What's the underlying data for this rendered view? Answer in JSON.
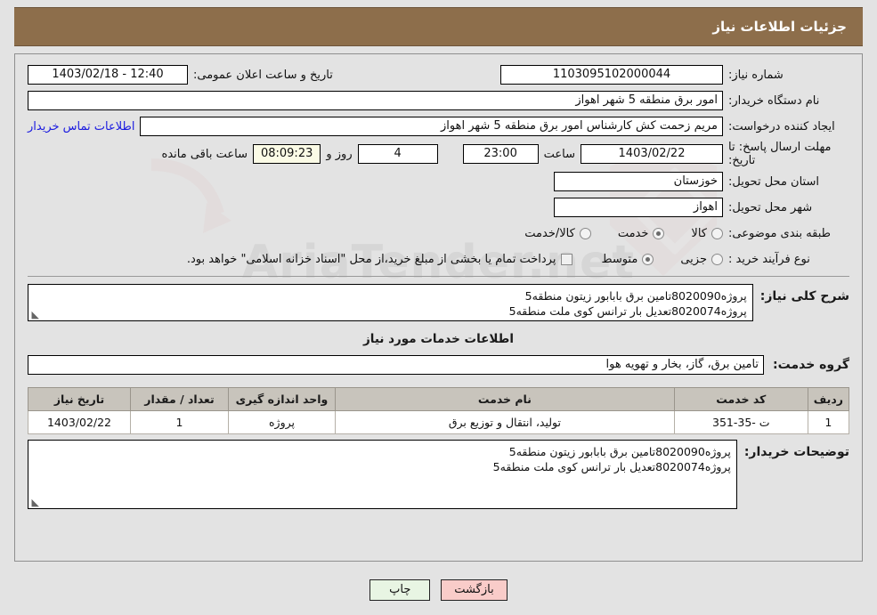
{
  "header": {
    "title": "جزئیات اطلاعات نیاز"
  },
  "form": {
    "need_number_label": "شماره نیاز:",
    "need_number_value": "1103095102000044",
    "public_announce_label": "تاریخ و ساعت اعلان عمومی:",
    "public_announce_value": "1403/02/18 - 12:40",
    "buyer_org_label": "نام دستگاه خریدار:",
    "buyer_org_value": "امور برق منطقه 5 شهر اهواز",
    "creator_label": "ایجاد کننده درخواست:",
    "creator_value": "مریم زحمت کش کارشناس امور برق منطقه 5 شهر اهواز",
    "contact_link": "اطلاعات تماس خریدار",
    "deadline_label": "مهلت ارسال پاسخ: تا تاریخ:",
    "deadline_date": "1403/02/22",
    "deadline_hour_label": "ساعت",
    "deadline_hour_value": "23:00",
    "days_value": "4",
    "days_suffix_label": "روز و",
    "remaining_value": "08:09:23",
    "remaining_label": "ساعت باقی مانده",
    "province_label": "استان محل تحویل:",
    "province_value": "خوزستان",
    "city_label": "شهر محل تحویل:",
    "city_value": "اهواز",
    "category_label": "طبقه بندی موضوعی:",
    "category_options": [
      {
        "label": "کالا",
        "selected": false
      },
      {
        "label": "خدمت",
        "selected": true
      },
      {
        "label": "کالا/خدمت",
        "selected": false
      }
    ],
    "process_label": "نوع فرآیند خرید :",
    "process_options": [
      {
        "label": "جزیی",
        "selected": false
      },
      {
        "label": "متوسط",
        "selected": true
      }
    ],
    "treasury_note": "پرداخت تمام یا بخشی از مبلغ خرید،از محل \"اسناد خزانه اسلامی\" خواهد بود.",
    "summary_label": "شرح کلی نیاز:",
    "summary_lines": [
      "پروژه8020090تامین برق بابابور زیتون منطقه5",
      "پروژه8020074تعدیل بار ترانس کوی ملت منطقه5"
    ],
    "services_section_title": "اطلاعات خدمات مورد نیاز",
    "service_group_label": "گروه خدمت:",
    "service_group_value": "تامین برق، گاز، بخار و تهویه هوا",
    "buyer_notes_label": "توضیحات خریدار:",
    "buyer_notes_lines": [
      "پروژه8020090تامین برق بابابور زیتون منطقه5",
      "پروژه8020074تعدیل بار ترانس کوی ملت منطقه5"
    ]
  },
  "table": {
    "columns": [
      "ردیف",
      "کد خدمت",
      "نام خدمت",
      "واحد اندازه گیری",
      "تعداد / مقدار",
      "تاریخ نیاز"
    ],
    "rows": [
      {
        "radif": "1",
        "code": "ت -35-351",
        "name": "تولید، انتقال و توزیع برق",
        "unit": "پروژه",
        "qty": "1",
        "date": "1403/02/22"
      }
    ]
  },
  "footer": {
    "print_label": "چاپ",
    "back_label": "بازگشت"
  },
  "watermark": {
    "text": "AriaTender.net"
  },
  "colors": {
    "header_band": "#8d6e4b",
    "page_bg": "#e3e3e3",
    "link": "#1a1ae0",
    "table_header": "#c8c4bc",
    "print_btn": "#e8f5e3",
    "back_btn": "#f9ccc9",
    "remaining_bg": "#fbfbe6"
  }
}
